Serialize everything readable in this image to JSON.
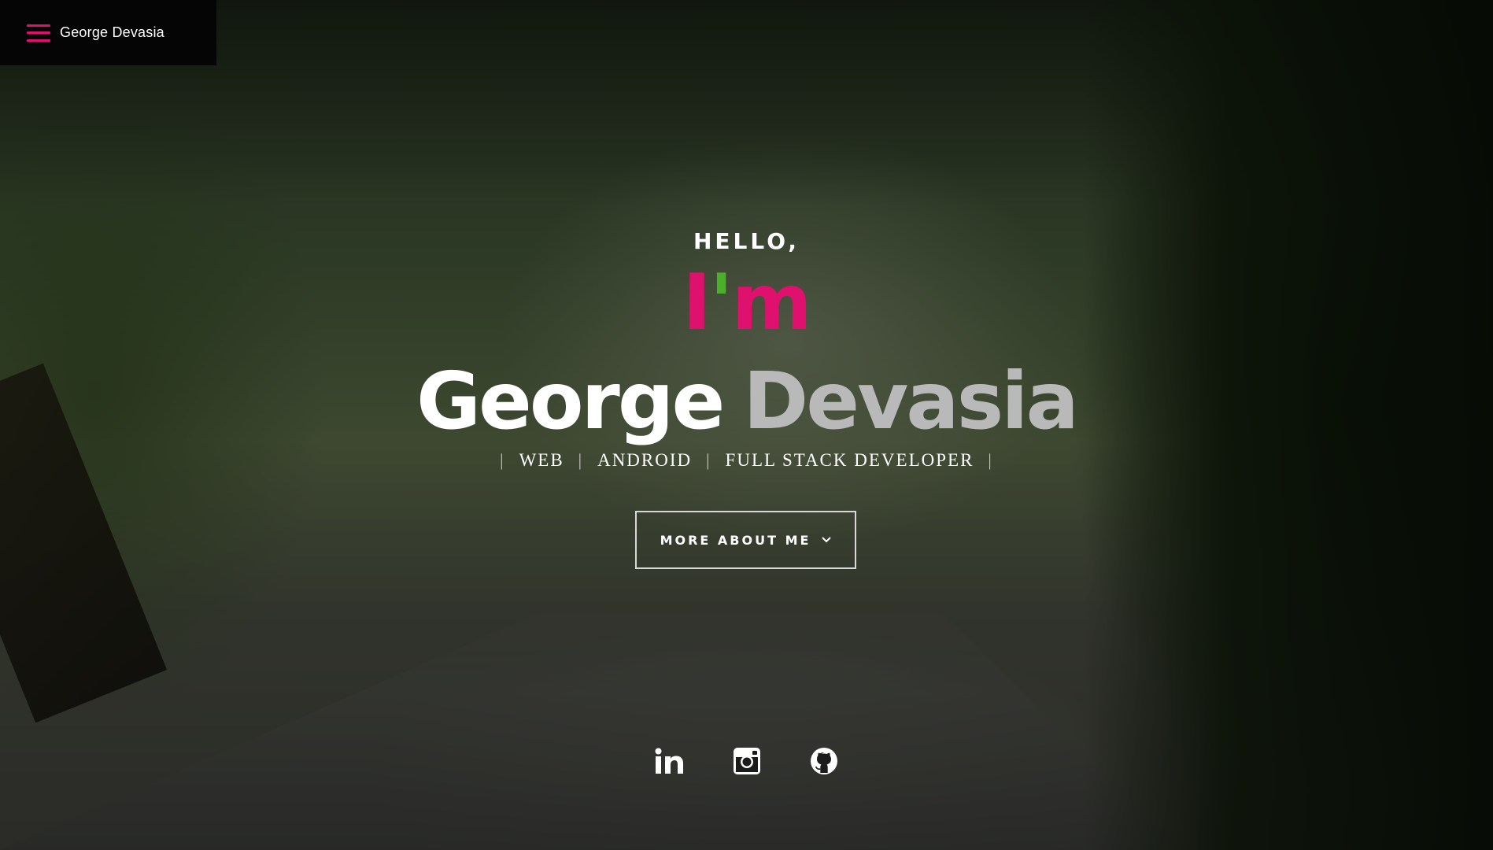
{
  "header": {
    "site_title": "George Devasia",
    "menu_icon": "hamburger-menu-icon",
    "accent_color": "#e0106e"
  },
  "hero": {
    "greeting": "HELLO,",
    "im": {
      "i": "I",
      "apostrophe": "'",
      "m": "m"
    },
    "name": {
      "first": "George",
      "last": "Devasia"
    },
    "roles": [
      "WEB",
      "ANDROID",
      "FULL STACK DEVELOPER"
    ],
    "separator": "|",
    "cta_label": "MORE ABOUT ME",
    "cta_icon": "chevron-down-icon",
    "colors": {
      "pink": "#e0106e",
      "green": "#4caf2a",
      "first_name": "#ffffff",
      "last_name": "#b9b9b9"
    }
  },
  "socials": [
    {
      "name": "LinkedIn",
      "icon": "linkedin-icon"
    },
    {
      "name": "Instagram",
      "icon": "instagram-icon"
    },
    {
      "name": "GitHub",
      "icon": "github-icon"
    }
  ]
}
